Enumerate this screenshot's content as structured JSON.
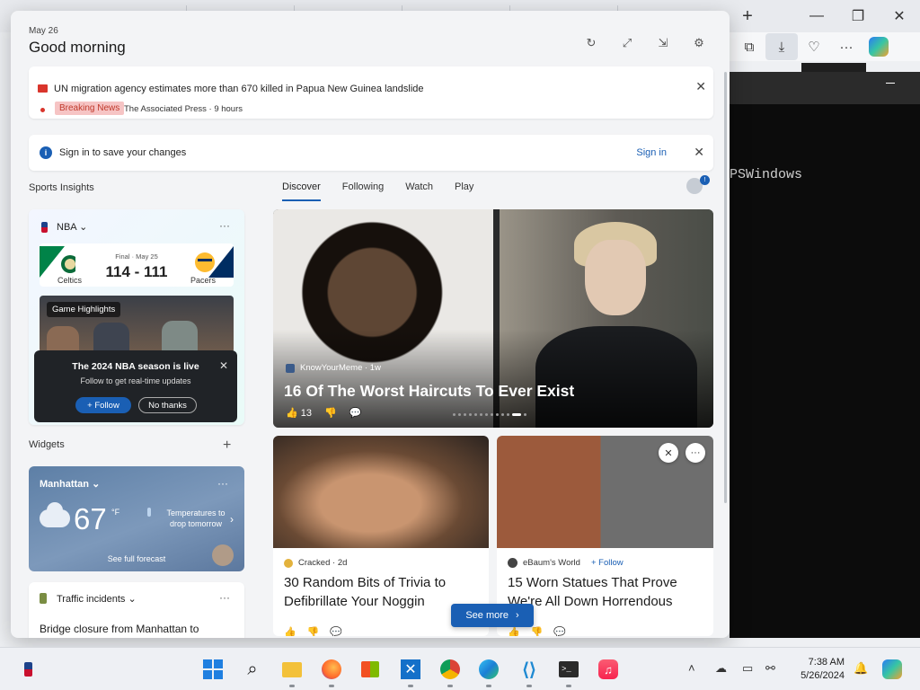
{
  "panel": {
    "date": "May 26",
    "greeting": "Good morning"
  },
  "breaking": {
    "headline": "UN migration agency estimates more than 670 killed in Papua New Guinea landslide",
    "tag": "Breaking News",
    "source": "The Associated Press · 9 hours"
  },
  "signin": {
    "message": "Sign in to save your changes",
    "link": "Sign in"
  },
  "sections": {
    "sports": "Sports Insights",
    "widgets": "Widgets"
  },
  "feed_tabs": [
    "Discover",
    "Following",
    "Watch",
    "Play"
  ],
  "nba": {
    "league": "NBA",
    "status": "Final · May 25",
    "score": "114 - 111",
    "home": "Celtics",
    "away": "Pacers",
    "highlights": "Game Highlights",
    "popup_title": "The 2024 NBA season is live",
    "popup_text": "Follow to get real-time updates",
    "follow": "Follow",
    "no_thanks": "No thanks"
  },
  "weather": {
    "city": "Manhattan",
    "temp": "67",
    "unit": "°F",
    "note": "Temperatures to drop tomorrow",
    "full": "See full forecast"
  },
  "traffic": {
    "title": "Traffic incidents",
    "desc": "Bridge closure from Manhattan to"
  },
  "stories": {
    "big": {
      "source": "KnowYourMeme · 1w",
      "title": "16 Of The Worst Haircuts To Ever Exist",
      "likes": "13"
    },
    "left": {
      "source": "Cracked · 2d",
      "title": "30 Random Bits of Trivia to Defibrillate Your Noggin"
    },
    "right": {
      "source": "eBaum's World",
      "follow": "+ Follow",
      "title": "15 Worn Statues That Prove We're All Down Horrendous"
    },
    "see_more": "See more"
  },
  "terminal": {
    "text": "PSWindows"
  },
  "clock": {
    "time": "7:38 AM",
    "date": "5/26/2024"
  },
  "colors": {
    "accent": "#1a5fb4",
    "breaking": "#d9352c"
  }
}
